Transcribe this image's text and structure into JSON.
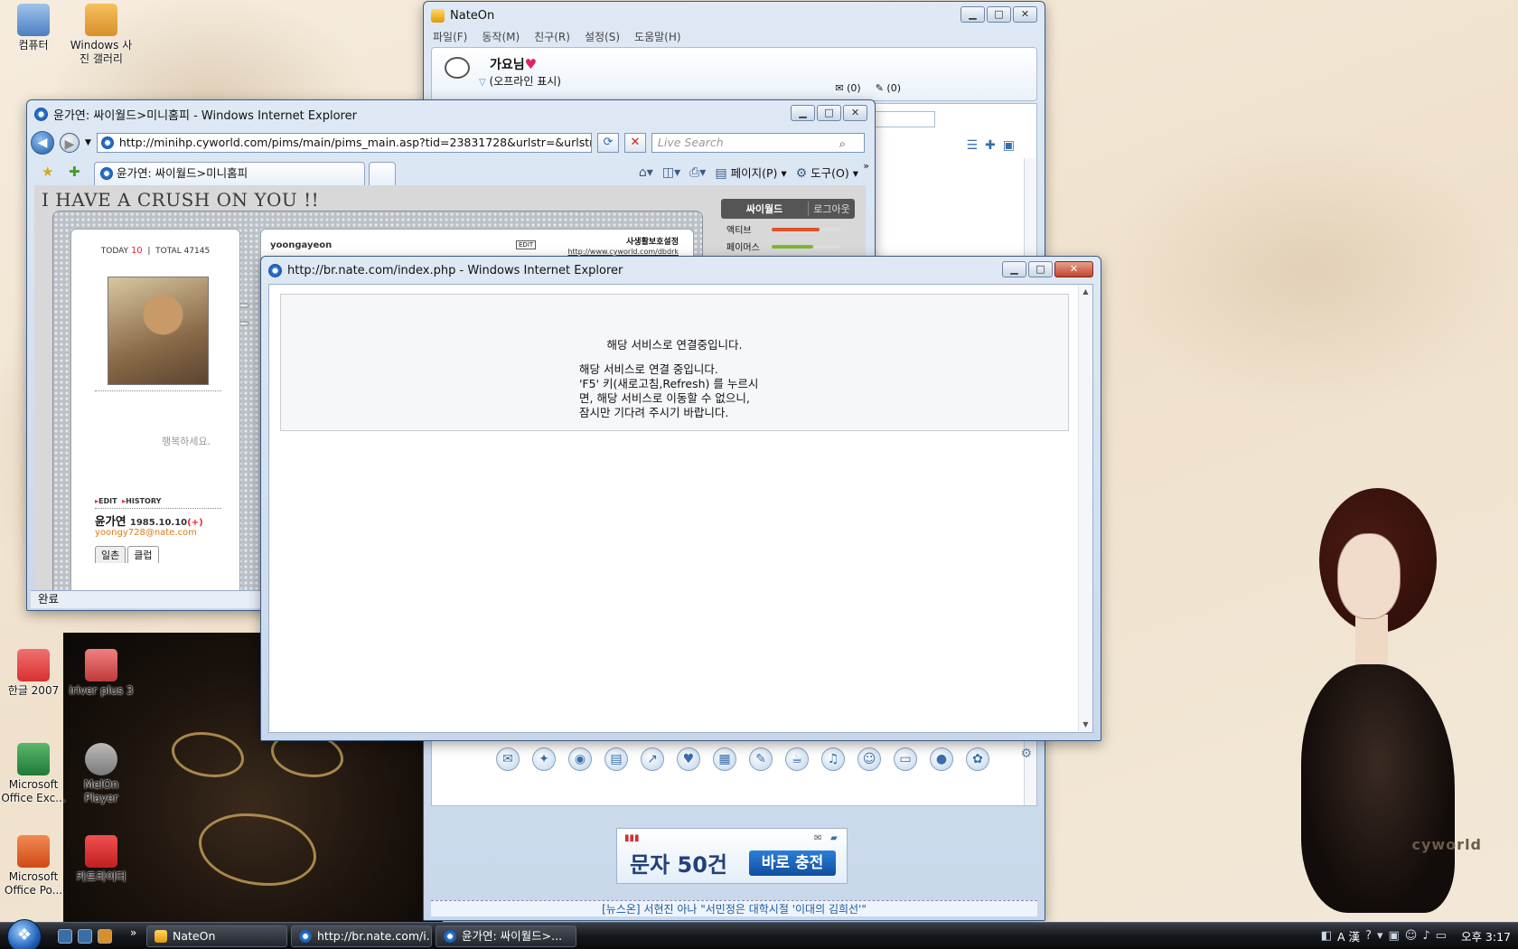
{
  "desktop": {
    "icons": [
      {
        "label": "컴퓨터",
        "color": "#4a7fc0"
      },
      {
        "label": "Windows 사진 갤러리",
        "color": "#d8902a"
      },
      {
        "label": "한글 2007",
        "color": "#d83030"
      },
      {
        "label": "iriver plus 3",
        "color": "#c03a3a"
      },
      {
        "label": "Microsoft Office Exc...",
        "color": "#1f7a3a"
      },
      {
        "label": "MelOn Player",
        "color": "#7a7a7a"
      },
      {
        "label": "Microsoft Office Po...",
        "color": "#d04a1a"
      },
      {
        "label": "카트라이더",
        "color": "#c02020"
      }
    ]
  },
  "nateon": {
    "title": "NateOn",
    "menu": [
      "파일(F)",
      "동작(M)",
      "친구(R)",
      "설정(S)",
      "도움말(H)"
    ],
    "nickname": "가요님",
    "status": "(오프라인 표시)",
    "mail_count": "(0)",
    "memo_count": "(0)",
    "ad": {
      "text": "문자 50건",
      "button": "바로 충전"
    },
    "news": "[뉴스온] 서현진 아나 \"서민정은 대학시절 '이대의 김희선'\""
  },
  "ie_main": {
    "title": "윤가연: 싸이월드>미니홈피 - Windows Internet Explorer",
    "url": "http://minihp.cyworld.com/pims/main/pims_main.asp?tid=23831728&urlstr=&urlstrsub=",
    "search_placeholder": "Live Search",
    "tab_label": "윤가연: 싸이월드>미니홈피",
    "page_menu": "페이지(P)",
    "tools_menu": "도구(O)",
    "status": "완료",
    "minihompy": {
      "header_text": "I HAVE A CRUSH ON YOU !!",
      "today_label": "TODAY",
      "today_value": "10",
      "total_label": "TOTAL",
      "total_value": "47145",
      "motto": "행복하세요.",
      "edit_label": "EDIT",
      "history_label": "HISTORY",
      "name": "윤가연",
      "birthday": "1985.10.10",
      "plus": "(+)",
      "email": "yoongy728@nate.com",
      "tabs": [
        "일촌",
        "클럽"
      ],
      "username": "yoongayeon",
      "edit_badge": "EDIT",
      "privacy": "사생활보호설정",
      "home_url": "http://www.cyworld.com/dbdrk",
      "cyworld_label": "싸이월드",
      "logout_label": "로그아웃",
      "stats": [
        {
          "label": "액티브",
          "color": "#e0522a",
          "level": 0.7
        },
        {
          "label": "페이머스",
          "color": "#7ab833",
          "level": 0.6
        }
      ]
    }
  },
  "ie_popup": {
    "title": "http://br.nate.com/index.php - Windows Internet Explorer",
    "heading": "해당 서비스로 연결중입니다.",
    "lines": [
      "해당 서비스로 연결 중입니다.",
      "'F5' 키(새로고침,Refresh) 를 누르시",
      "면, 해당 서비스로 이동할 수 없으니,",
      "잠시만 기다려 주시기 바랍니다."
    ]
  },
  "taskbar": {
    "tasks": [
      "NateOn",
      "http://br.nate.com/i...",
      "윤가연: 싸이월드>..."
    ],
    "ime": "A 漢",
    "clock": "오후 3:17"
  }
}
